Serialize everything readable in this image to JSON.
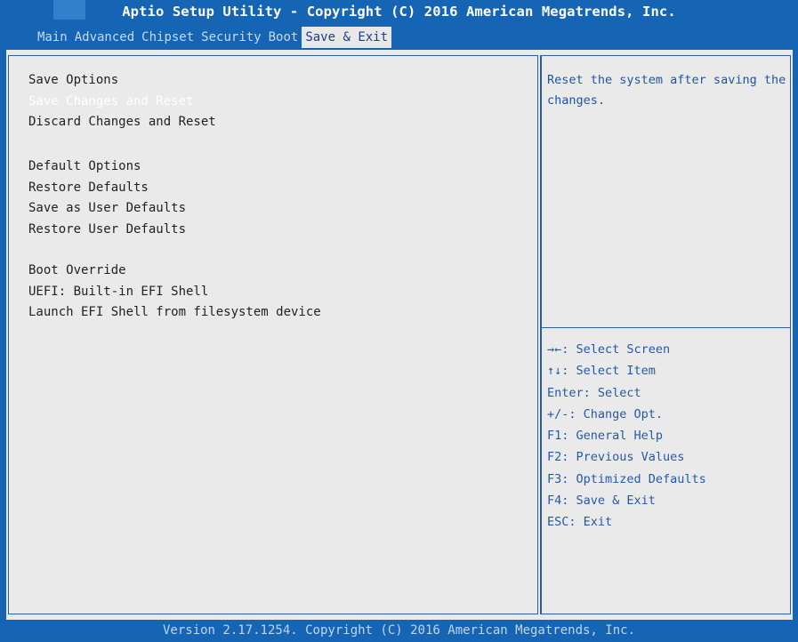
{
  "header": {
    "title": "Aptio Setup Utility - Copyright (C) 2016 American Megatrends, Inc."
  },
  "tabs": [
    {
      "label": "Main",
      "active": false
    },
    {
      "label": "Advanced",
      "active": false
    },
    {
      "label": "Chipset",
      "active": false
    },
    {
      "label": "Security",
      "active": false
    },
    {
      "label": "Boot",
      "active": false
    },
    {
      "label": "Save & Exit",
      "active": true
    }
  ],
  "menu": {
    "save_options": {
      "heading": "Save Options",
      "items": [
        "Save Changes and Reset",
        "Discard Changes and Reset"
      ],
      "selected_item": "Save Changes and Reset"
    },
    "default_options": {
      "heading": "Default Options",
      "items": [
        "Restore Defaults",
        "Save as User Defaults",
        "Restore User Defaults"
      ]
    },
    "boot_override": {
      "heading": "Boot Override",
      "items": [
        "UEFI: Built-in EFI Shell",
        "Launch EFI Shell from filesystem device"
      ]
    }
  },
  "help": {
    "text": "Reset the system after saving the changes."
  },
  "key_legend": [
    "→←: Select Screen",
    "↑↓: Select Item",
    "Enter: Select",
    "+/-: Change Opt.",
    "F1: General Help",
    "F2: Previous Values",
    "F3: Optimized Defaults",
    "F4: Save & Exit",
    "ESC: Exit"
  ],
  "footer": {
    "text": "Version 2.17.1254. Copyright (C) 2016 American Megatrends, Inc."
  },
  "colors": {
    "background_blue": "#1565b4",
    "panel_gray": "#eaeaea",
    "help_text_blue": "#1e55a6",
    "selected_text": "#ffffff",
    "active_tab_text": "#1f3c8a"
  }
}
